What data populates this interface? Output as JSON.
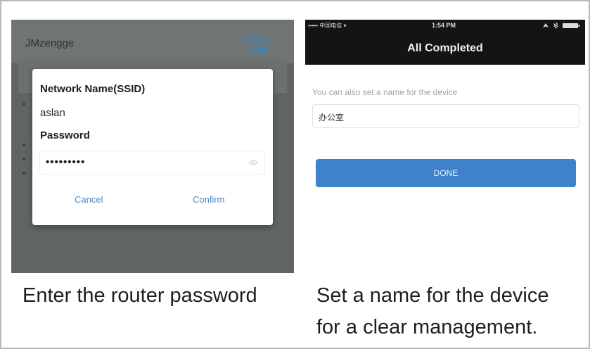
{
  "left_screen": {
    "wifi_name": "JMzengge",
    "dialog": {
      "ssid_label": "Network Name(SSID)",
      "ssid_value": "aslan",
      "password_label": "Password",
      "password_value": "•••••••••",
      "cancel_label": "Cancel",
      "confirm_label": "Confirm"
    },
    "caption": "Enter the router password"
  },
  "right_screen": {
    "status_bar": {
      "carrier": "••••• 中国电信 ▾",
      "time": "1:54 PM"
    },
    "title": "All Completed",
    "hint": "You can also set a name for the device",
    "device_name_value": "办公室",
    "done_label": "DONE",
    "caption_line1": "Set a name for the device",
    "caption_line2": "for a clear management."
  },
  "icons": [
    "wifi-lock-icon",
    "chevron-right-icon",
    "eye-icon",
    "location-icon",
    "bluetooth-icon",
    "battery-icon"
  ],
  "colors": {
    "accent_blue": "#3e82c9",
    "link_blue": "#4e86c0",
    "nav_bar": "#141414",
    "overlay": "#5f6565"
  }
}
